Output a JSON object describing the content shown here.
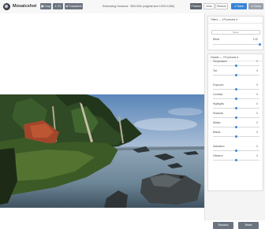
{
  "app": {
    "brand": "Mosaicshot"
  },
  "toolbar": {
    "buttons": [
      {
        "icon": "▣",
        "label": "Crop"
      },
      {
        "icon": "◐",
        "label": "Fx"
      },
      {
        "icon": "⇄",
        "label": "Transform"
      }
    ],
    "status": "Embracing Horizons · 800×534 (original size 1920×1280)",
    "right_buttons": [
      {
        "label": "Preview"
      },
      {
        "label": "Undo"
      },
      {
        "label": "Restore"
      },
      {
        "label": "Save"
      },
      {
        "label": "Close"
      }
    ]
  },
  "panel": {
    "filters": {
      "title": "Filters — 1/9 presets ▾",
      "select_value": "None",
      "blend_label": "Blend",
      "blend_value": "1.00",
      "blend_level": 1.0
    },
    "details": {
      "title": "Details — 7/9 presets ▾",
      "sliders": [
        {
          "label": "Temperature",
          "value": "0",
          "level": 0.5
        },
        {
          "label": "Tint",
          "value": "0",
          "level": 0.5
        },
        {
          "label": "Exposure",
          "value": "0",
          "level": 0.5
        },
        {
          "label": "Contrast",
          "value": "0",
          "level": 0.5
        },
        {
          "label": "Highlights",
          "value": "0",
          "level": 0.5
        },
        {
          "label": "Shadows",
          "value": "0",
          "level": 0.5
        },
        {
          "label": "Whites",
          "value": "0",
          "level": 0.5
        },
        {
          "label": "Blacks",
          "value": "0",
          "level": 0.5
        },
        {
          "label": "Saturation",
          "value": "0",
          "level": 0.5
        },
        {
          "label": "Vibrance",
          "value": "0",
          "level": 0.5
        }
      ],
      "buttons": [
        {
          "label": "Random"
        },
        {
          "label": "Reset"
        }
      ]
    }
  },
  "colors": {
    "accent": "#3a86d8",
    "button": "#6c7480"
  }
}
